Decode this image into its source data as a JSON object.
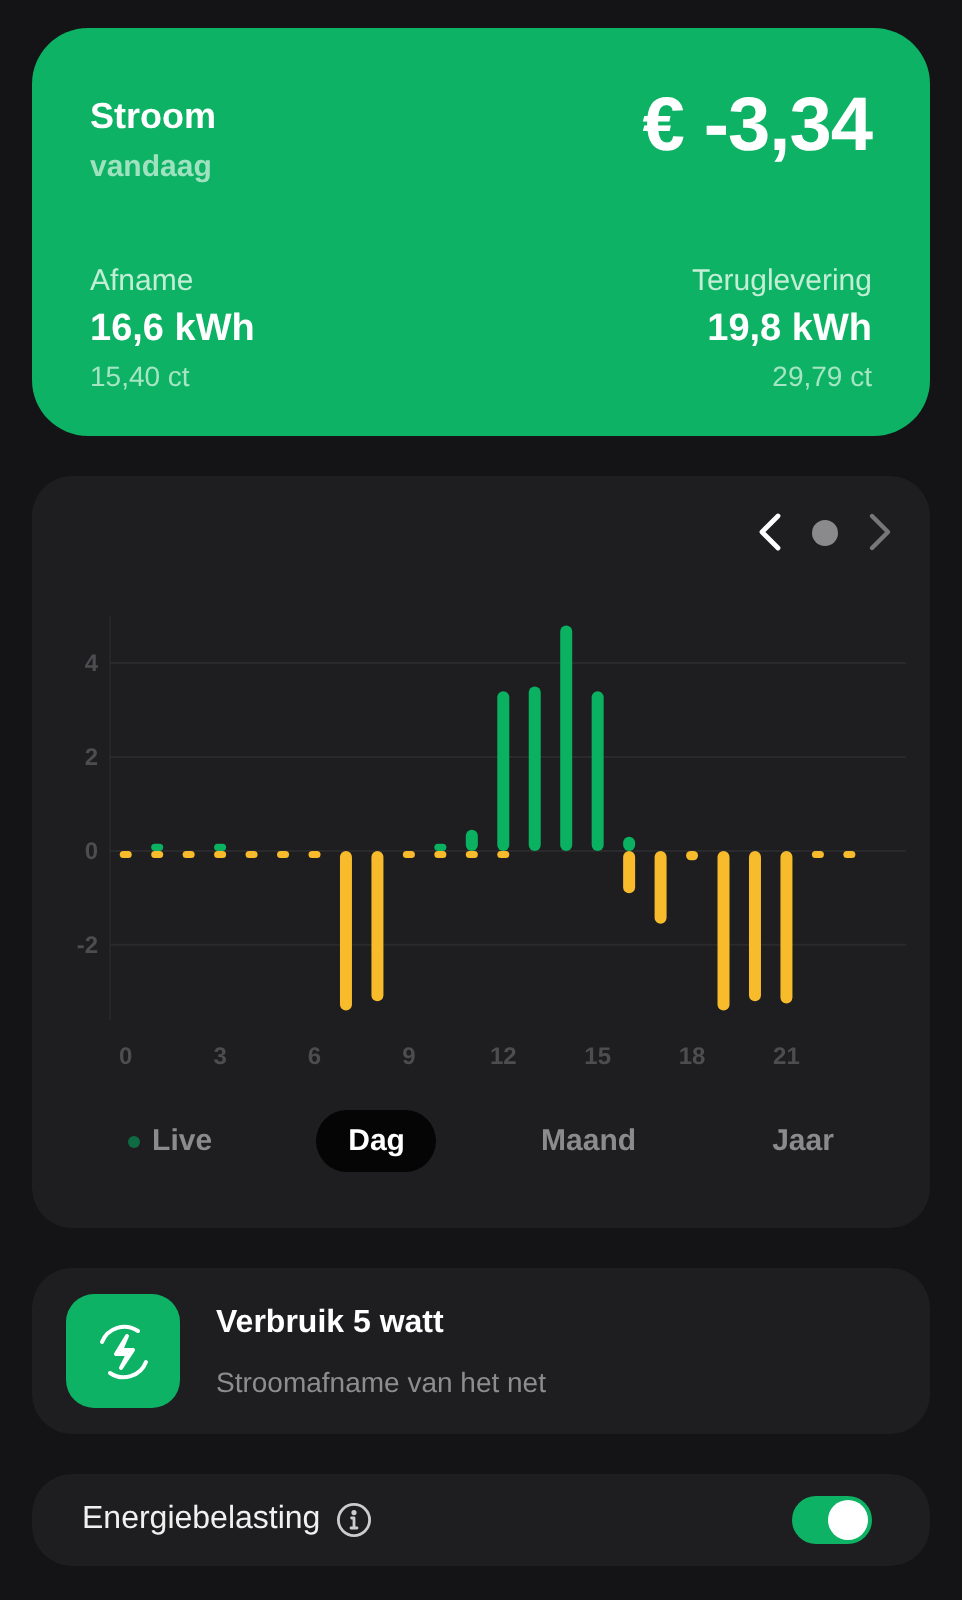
{
  "summary": {
    "title": "Stroom",
    "subtitle": "vandaag",
    "amount": "€ -3,34",
    "stats": [
      {
        "label": "Afname",
        "value": "16,6 kWh",
        "price": "15,40 ct"
      },
      {
        "label": "Teruglevering",
        "value": "19,8 kWh",
        "price": "29,79 ct"
      }
    ]
  },
  "chart_card": {
    "nav": {
      "next_disabled": true
    },
    "chart_data": {
      "type": "bar",
      "stacked": true,
      "grid": true,
      "x": [
        0,
        1,
        2,
        3,
        4,
        5,
        6,
        7,
        8,
        9,
        10,
        11,
        12,
        13,
        14,
        15,
        16,
        17,
        18,
        19,
        20,
        21,
        22,
        23
      ],
      "series": [
        {
          "color": "#0ab161",
          "values": [
            0,
            0.15,
            0,
            0.15,
            0,
            0,
            0,
            0,
            0,
            0,
            0.15,
            0.45,
            3.4,
            3.5,
            4.8,
            3.4,
            0.3,
            0,
            0,
            0,
            0,
            0,
            0,
            0
          ]
        },
        {
          "color": "#f7bb2c",
          "values": [
            -0.15,
            -0.15,
            -0.15,
            -0.15,
            -0.15,
            -0.15,
            -0.15,
            -3.4,
            -3.2,
            -0.15,
            -0.15,
            -0.15,
            -0.15,
            0,
            0,
            0,
            -0.9,
            -1.55,
            -0.2,
            -3.4,
            -3.2,
            -3.25,
            -0.15,
            -0.15
          ]
        }
      ],
      "xlim": [
        -0.5,
        24.8
      ],
      "ylim": [
        -3.6,
        5
      ],
      "yticks": [
        -2,
        0,
        2,
        4
      ],
      "xticks": [
        0,
        3,
        6,
        9,
        12,
        15,
        18,
        21
      ]
    },
    "tabs": [
      {
        "label": "Live",
        "kind": "live",
        "selected": false
      },
      {
        "label": "Dag",
        "kind": "period",
        "selected": true
      },
      {
        "label": "Maand",
        "kind": "period",
        "selected": false
      },
      {
        "label": "Jaar",
        "kind": "period",
        "selected": false
      }
    ]
  },
  "usage": {
    "title": "Verbruik 5 watt",
    "subtitle": "Stroomafname van het net"
  },
  "setting": {
    "label": "Energiebelasting",
    "on": true
  }
}
